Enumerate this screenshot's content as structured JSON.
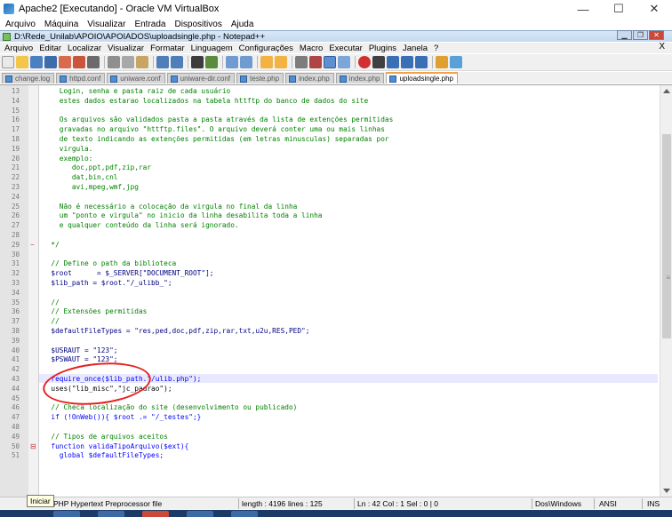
{
  "vbox": {
    "title": "Apache2 [Executando] - Oracle VM VirtualBox",
    "menu": [
      "Arquivo",
      "Máquina",
      "Visualizar",
      "Entrada",
      "Dispositivos",
      "Ajuda"
    ],
    "minimize": "—",
    "maximize": "☐",
    "close": "✕"
  },
  "npp": {
    "title": "D:\\Rede_Unilab\\APOIO\\APOIADOS\\uploadsingle.php - Notepad++",
    "menu": [
      "Arquivo",
      "Editar",
      "Localizar",
      "Visualizar",
      "Formatar",
      "Linguagem",
      "Configurações",
      "Macro",
      "Executar",
      "Plugins",
      "Janela",
      "?"
    ],
    "menu_close": "X"
  },
  "tabs": [
    {
      "label": "change.log",
      "active": false
    },
    {
      "label": "httpd.conf",
      "active": false
    },
    {
      "label": "uniware.conf",
      "active": false
    },
    {
      "label": "uniware-dir.conf",
      "active": false
    },
    {
      "label": "teste.php",
      "active": false
    },
    {
      "label": "index.php",
      "active": false
    },
    {
      "label": "index.php",
      "active": false
    },
    {
      "label": "uploadsingle.php",
      "active": true
    }
  ],
  "code": [
    {
      "n": "13",
      "t": "    Login, senha e pasta raiz de cada usuário",
      "c": "comment"
    },
    {
      "n": "14",
      "t": "    estes dados estarao localizados na tabela httftp do banco de dados do site",
      "c": "comment"
    },
    {
      "n": "15",
      "t": "",
      "c": "comment"
    },
    {
      "n": "16",
      "t": "    Os arquivos são validados pasta a pasta através da lista de extenções permitidas",
      "c": "comment"
    },
    {
      "n": "17",
      "t": "    gravadas no arquivo \"httftp.files\". O arquivo deverá conter uma ou mais linhas",
      "c": "comment"
    },
    {
      "n": "18",
      "t": "    de texto indicando as extenções permitidas (em letras minusculas) separadas por",
      "c": "comment"
    },
    {
      "n": "19",
      "t": "    virgula.",
      "c": "comment"
    },
    {
      "n": "20",
      "t": "    exemplo:",
      "c": "comment"
    },
    {
      "n": "21",
      "t": "       doc,ppt,pdf,zip,rar",
      "c": "comment"
    },
    {
      "n": "22",
      "t": "       dat,bin,cnl",
      "c": "comment"
    },
    {
      "n": "23",
      "t": "       avi,mpeg,wmf,jpg",
      "c": "comment"
    },
    {
      "n": "24",
      "t": "",
      "c": "comment"
    },
    {
      "n": "25",
      "t": "    Não é necessário a colocação da virgula no final da linha",
      "c": "comment"
    },
    {
      "n": "26",
      "t": "    um \"ponto e virgula\" no inicio da linha desabilita toda a linha",
      "c": "comment"
    },
    {
      "n": "27",
      "t": "    e qualquer conteúdo da linha será ignorado.",
      "c": "comment"
    },
    {
      "n": "28",
      "t": "",
      "c": "comment"
    },
    {
      "n": "29",
      "t": "  */",
      "c": "comment"
    },
    {
      "n": "30",
      "t": "",
      "c": "plain"
    },
    {
      "n": "31",
      "t": "  // Define o path da biblioteca",
      "c": "comment"
    },
    {
      "n": "32",
      "t": "  $root      = $_SERVER[\"DOCUMENT_ROOT\"];",
      "c": "var"
    },
    {
      "n": "33",
      "t": "  $lib_path = $root.\"/_ulibb_\";",
      "c": "var"
    },
    {
      "n": "34",
      "t": "",
      "c": "plain"
    },
    {
      "n": "35",
      "t": "  //",
      "c": "comment"
    },
    {
      "n": "36",
      "t": "  // Extensões permitidas",
      "c": "comment"
    },
    {
      "n": "37",
      "t": "  //",
      "c": "comment"
    },
    {
      "n": "38",
      "t": "  $defaultFileTypes = \"res,ped,doc,pdf,zip,rar,txt,u2u,RES,PED\";",
      "c": "var"
    },
    {
      "n": "39",
      "t": "",
      "c": "plain"
    },
    {
      "n": "40",
      "t": "  $USRAUT = \"123\";",
      "c": "var"
    },
    {
      "n": "41",
      "t": "  $PSWAUT = \"123\";",
      "c": "var"
    },
    {
      "n": "42",
      "t": "",
      "c": "plain"
    },
    {
      "n": "43",
      "t": "  require_once($lib_path.\"/ulib.php\");",
      "c": "kw"
    },
    {
      "n": "44",
      "t": "  uses(\"lib_misc\",\"jc_padrao\");",
      "c": "plain"
    },
    {
      "n": "45",
      "t": "",
      "c": "plain"
    },
    {
      "n": "46",
      "t": "  // Checa localização do site (desenvolvimento ou publicado)",
      "c": "comment"
    },
    {
      "n": "47",
      "t": "  if (!OnWeb()){ $root .= \"/_testes\";}",
      "c": "kw"
    },
    {
      "n": "48",
      "t": "",
      "c": "plain"
    },
    {
      "n": "49",
      "t": "  // Tipos de arquivos aceitos",
      "c": "comment"
    },
    {
      "n": "50",
      "t": "  function validaTipoArquivo($ext){",
      "c": "kw"
    },
    {
      "n": "51",
      "t": "    global $defaultFileTypes;",
      "c": "kw"
    }
  ],
  "status": {
    "filetype": "PHP Hypertext Preprocessor file",
    "length": "length : 4196",
    "lines": "lines : 125",
    "position": "Ln : 42    Col : 1    Sel : 0 | 0",
    "eol": "Dos\\Windows",
    "encoding": "ANSI",
    "mode": "INS"
  },
  "tooltip": "Iniciar",
  "colors": {
    "annotation": "#e82020",
    "current_line": "#e8e8ff",
    "comment": "#008000"
  }
}
